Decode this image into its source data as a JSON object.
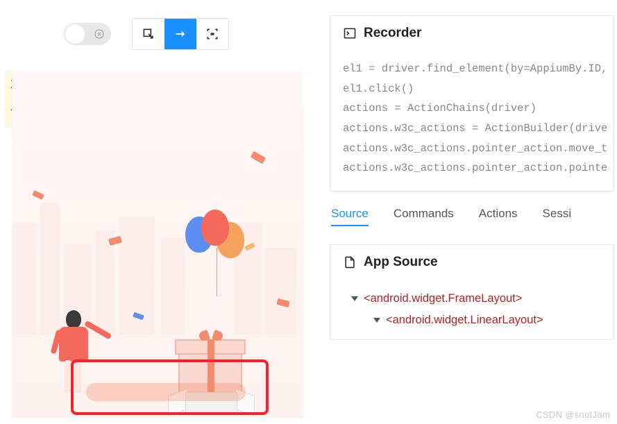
{
  "coords": {
    "x_label": "X:",
    "y_label": "Y:"
  },
  "recorder": {
    "title": "Recorder",
    "code": "el1 = driver.find_element(by=AppiumBy.ID,\nel1.click()\nactions = ActionChains(driver)\nactions.w3c_actions = ActionBuilder(drive\nactions.w3c_actions.pointer_action.move_t\nactions.w3c_actions.pointer_action.pointe"
  },
  "tabs": {
    "source": "Source",
    "commands": "Commands",
    "actions": "Actions",
    "session": "Sessi"
  },
  "app_source": {
    "title": "App Source",
    "nodes": {
      "n0": "<android.widget.FrameLayout>",
      "n1": "<android.widget.LinearLayout>"
    }
  },
  "watermark": "CSDN @snotJam"
}
